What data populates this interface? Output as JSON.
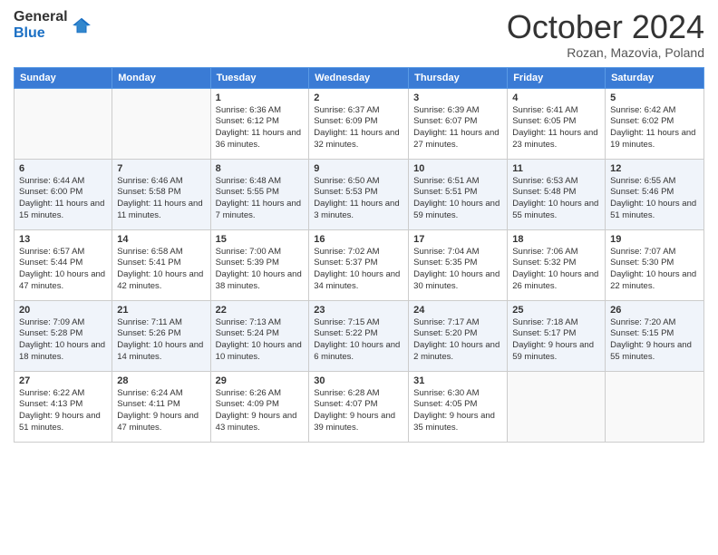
{
  "logo": {
    "general": "General",
    "blue": "Blue"
  },
  "title": "October 2024",
  "subtitle": "Rozan, Mazovia, Poland",
  "days_of_week": [
    "Sunday",
    "Monday",
    "Tuesday",
    "Wednesday",
    "Thursday",
    "Friday",
    "Saturday"
  ],
  "weeks": [
    [
      {
        "day": "",
        "info": ""
      },
      {
        "day": "",
        "info": ""
      },
      {
        "day": "1",
        "info": "Sunrise: 6:36 AM\nSunset: 6:12 PM\nDaylight: 11 hours and 36 minutes."
      },
      {
        "day": "2",
        "info": "Sunrise: 6:37 AM\nSunset: 6:09 PM\nDaylight: 11 hours and 32 minutes."
      },
      {
        "day": "3",
        "info": "Sunrise: 6:39 AM\nSunset: 6:07 PM\nDaylight: 11 hours and 27 minutes."
      },
      {
        "day": "4",
        "info": "Sunrise: 6:41 AM\nSunset: 6:05 PM\nDaylight: 11 hours and 23 minutes."
      },
      {
        "day": "5",
        "info": "Sunrise: 6:42 AM\nSunset: 6:02 PM\nDaylight: 11 hours and 19 minutes."
      }
    ],
    [
      {
        "day": "6",
        "info": "Sunrise: 6:44 AM\nSunset: 6:00 PM\nDaylight: 11 hours and 15 minutes."
      },
      {
        "day": "7",
        "info": "Sunrise: 6:46 AM\nSunset: 5:58 PM\nDaylight: 11 hours and 11 minutes."
      },
      {
        "day": "8",
        "info": "Sunrise: 6:48 AM\nSunset: 5:55 PM\nDaylight: 11 hours and 7 minutes."
      },
      {
        "day": "9",
        "info": "Sunrise: 6:50 AM\nSunset: 5:53 PM\nDaylight: 11 hours and 3 minutes."
      },
      {
        "day": "10",
        "info": "Sunrise: 6:51 AM\nSunset: 5:51 PM\nDaylight: 10 hours and 59 minutes."
      },
      {
        "day": "11",
        "info": "Sunrise: 6:53 AM\nSunset: 5:48 PM\nDaylight: 10 hours and 55 minutes."
      },
      {
        "day": "12",
        "info": "Sunrise: 6:55 AM\nSunset: 5:46 PM\nDaylight: 10 hours and 51 minutes."
      }
    ],
    [
      {
        "day": "13",
        "info": "Sunrise: 6:57 AM\nSunset: 5:44 PM\nDaylight: 10 hours and 47 minutes."
      },
      {
        "day": "14",
        "info": "Sunrise: 6:58 AM\nSunset: 5:41 PM\nDaylight: 10 hours and 42 minutes."
      },
      {
        "day": "15",
        "info": "Sunrise: 7:00 AM\nSunset: 5:39 PM\nDaylight: 10 hours and 38 minutes."
      },
      {
        "day": "16",
        "info": "Sunrise: 7:02 AM\nSunset: 5:37 PM\nDaylight: 10 hours and 34 minutes."
      },
      {
        "day": "17",
        "info": "Sunrise: 7:04 AM\nSunset: 5:35 PM\nDaylight: 10 hours and 30 minutes."
      },
      {
        "day": "18",
        "info": "Sunrise: 7:06 AM\nSunset: 5:32 PM\nDaylight: 10 hours and 26 minutes."
      },
      {
        "day": "19",
        "info": "Sunrise: 7:07 AM\nSunset: 5:30 PM\nDaylight: 10 hours and 22 minutes."
      }
    ],
    [
      {
        "day": "20",
        "info": "Sunrise: 7:09 AM\nSunset: 5:28 PM\nDaylight: 10 hours and 18 minutes."
      },
      {
        "day": "21",
        "info": "Sunrise: 7:11 AM\nSunset: 5:26 PM\nDaylight: 10 hours and 14 minutes."
      },
      {
        "day": "22",
        "info": "Sunrise: 7:13 AM\nSunset: 5:24 PM\nDaylight: 10 hours and 10 minutes."
      },
      {
        "day": "23",
        "info": "Sunrise: 7:15 AM\nSunset: 5:22 PM\nDaylight: 10 hours and 6 minutes."
      },
      {
        "day": "24",
        "info": "Sunrise: 7:17 AM\nSunset: 5:20 PM\nDaylight: 10 hours and 2 minutes."
      },
      {
        "day": "25",
        "info": "Sunrise: 7:18 AM\nSunset: 5:17 PM\nDaylight: 9 hours and 59 minutes."
      },
      {
        "day": "26",
        "info": "Sunrise: 7:20 AM\nSunset: 5:15 PM\nDaylight: 9 hours and 55 minutes."
      }
    ],
    [
      {
        "day": "27",
        "info": "Sunrise: 6:22 AM\nSunset: 4:13 PM\nDaylight: 9 hours and 51 minutes."
      },
      {
        "day": "28",
        "info": "Sunrise: 6:24 AM\nSunset: 4:11 PM\nDaylight: 9 hours and 47 minutes."
      },
      {
        "day": "29",
        "info": "Sunrise: 6:26 AM\nSunset: 4:09 PM\nDaylight: 9 hours and 43 minutes."
      },
      {
        "day": "30",
        "info": "Sunrise: 6:28 AM\nSunset: 4:07 PM\nDaylight: 9 hours and 39 minutes."
      },
      {
        "day": "31",
        "info": "Sunrise: 6:30 AM\nSunset: 4:05 PM\nDaylight: 9 hours and 35 minutes."
      },
      {
        "day": "",
        "info": ""
      },
      {
        "day": "",
        "info": ""
      }
    ]
  ]
}
